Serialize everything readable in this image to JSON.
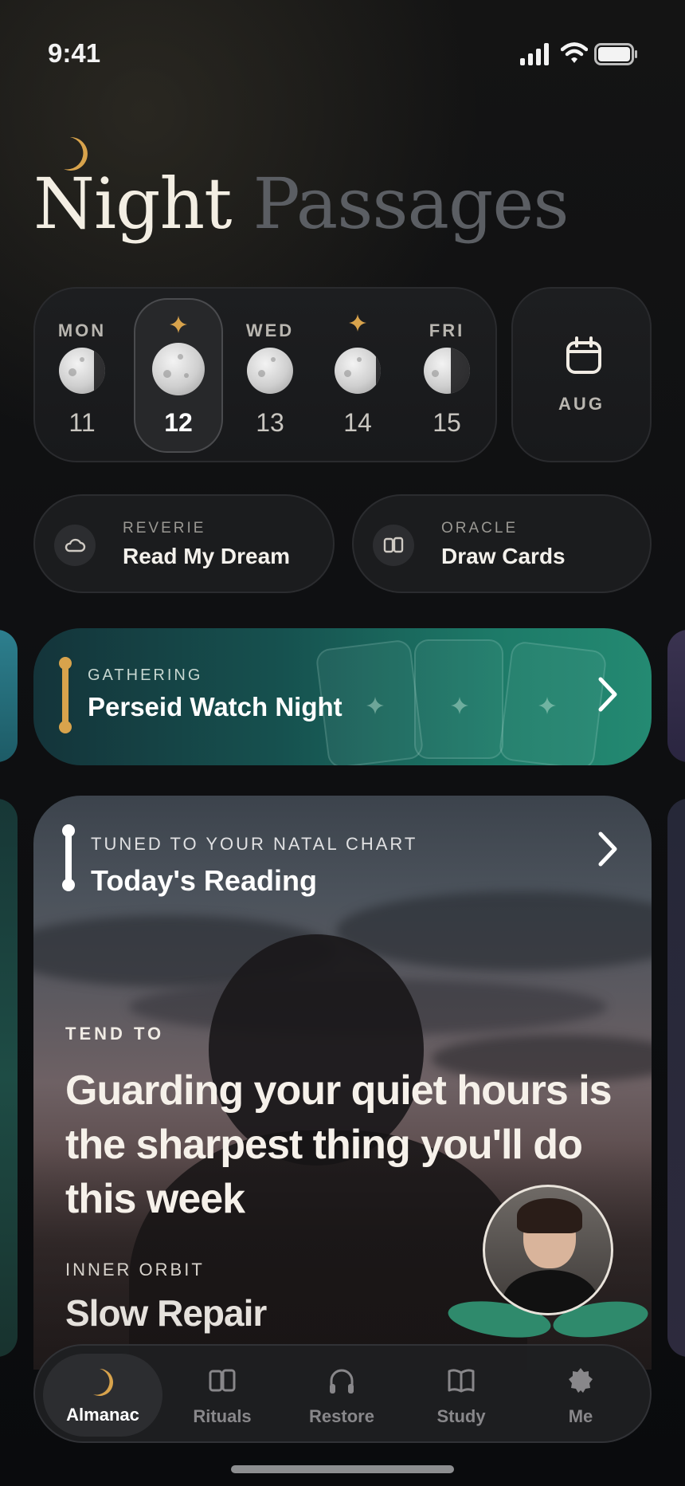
{
  "status": {
    "time": "9:41"
  },
  "header": {
    "title_primary": "Night",
    "title_secondary": "Passages"
  },
  "week": {
    "days": [
      {
        "name": "MON",
        "num": "11",
        "selected": false,
        "star": false
      },
      {
        "name": "",
        "num": "12",
        "selected": true,
        "star": true
      },
      {
        "name": "WED",
        "num": "13",
        "selected": false,
        "star": false
      },
      {
        "name": "",
        "num": "14",
        "selected": false,
        "star": true
      },
      {
        "name": "FRI",
        "num": "15",
        "selected": false,
        "star": false
      }
    ],
    "month_label": "AUG"
  },
  "quick_actions": [
    {
      "kicker": "REVERIE",
      "label": "Read My Dream",
      "icon": "cloud-icon"
    },
    {
      "kicker": "ORACLE",
      "label": "Draw Cards",
      "icon": "cards-icon"
    }
  ],
  "gathering": {
    "kicker": "GATHERING",
    "title": "Perseid Watch Night"
  },
  "reading": {
    "kicker": "TUNED TO YOUR NATAL CHART",
    "title": "Today's Reading",
    "tend_label": "TEND TO",
    "quote": "Guarding your quiet hours is the sharpest thing you'll do this week",
    "orbit_label": "INNER ORBIT",
    "orbit_title": "Slow Repair"
  },
  "tabs": [
    {
      "label": "Almanac",
      "icon": "moon-icon",
      "active": true
    },
    {
      "label": "Rituals",
      "icon": "cards-icon",
      "active": false
    },
    {
      "label": "Restore",
      "icon": "headphones-icon",
      "active": false
    },
    {
      "label": "Study",
      "icon": "book-icon",
      "active": false
    },
    {
      "label": "Me",
      "icon": "badge-icon",
      "active": false
    }
  ],
  "colors": {
    "accent_gold": "#d8a34c",
    "teal": "#1d7a68",
    "bg": "#0c0d0f"
  }
}
